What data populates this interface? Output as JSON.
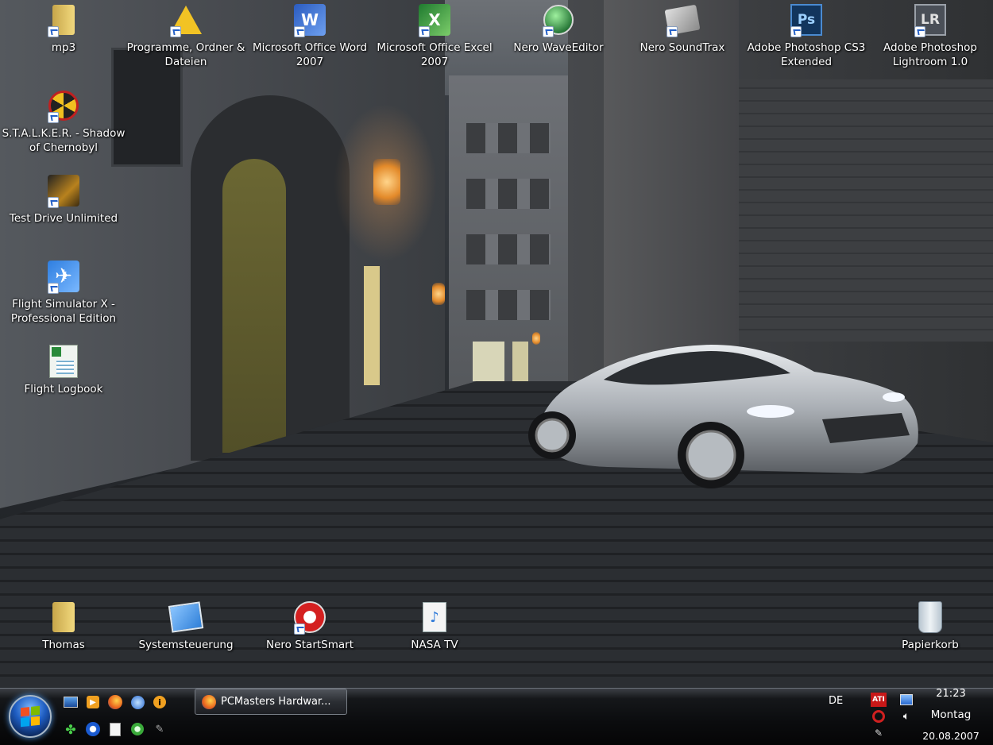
{
  "desktop": {
    "icons": [
      {
        "label": "mp3"
      },
      {
        "label": "Programme, Ordner & Dateien"
      },
      {
        "label": "Microsoft Office Word 2007"
      },
      {
        "label": "Microsoft Office Excel 2007"
      },
      {
        "label": "Nero WaveEditor"
      },
      {
        "label": "Nero SoundTrax"
      },
      {
        "label": "Adobe Photoshop CS3 Extended"
      },
      {
        "label": "Adobe Photoshop Lightroom 1.0"
      },
      {
        "label": "S.T.A.L.K.E.R. - Shadow of Chernobyl"
      },
      {
        "label": "Test Drive Unlimited"
      },
      {
        "label": "Flight Simulator X - Professional Edition"
      },
      {
        "label": "Flight Logbook"
      },
      {
        "label": "Thomas"
      },
      {
        "label": "Systemsteuerung"
      },
      {
        "label": "Nero StartSmart"
      },
      {
        "label": "NASA TV"
      },
      {
        "label": "Papierkorb"
      }
    ]
  },
  "taskbar": {
    "window_button": "PCMasters Hardwar...",
    "language": "DE",
    "ati_label": "ATI"
  },
  "clock": {
    "time": "21:23",
    "day": "Montag",
    "date": "20.08.2007"
  }
}
